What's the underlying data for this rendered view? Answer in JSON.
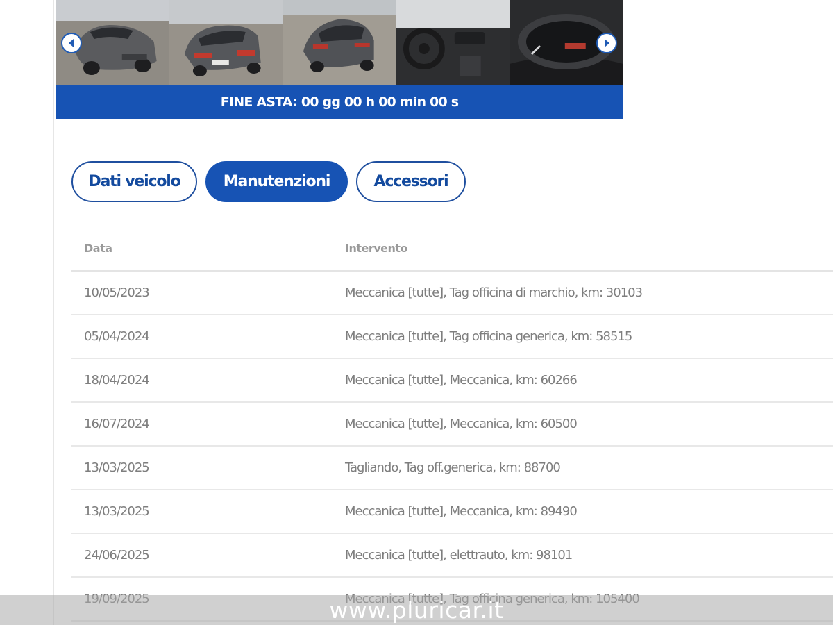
{
  "gallery": {
    "photos": [
      {
        "icon": "car-front-photo"
      },
      {
        "icon": "car-rear-photo"
      },
      {
        "icon": "car-rear-side-photo"
      },
      {
        "icon": "steering-wheel-photo"
      },
      {
        "icon": "dashboard-cluster-photo"
      }
    ],
    "prev_icon": "chevron-left-icon",
    "next_icon": "chevron-right-icon"
  },
  "countdown": {
    "label": "FINE ASTA:",
    "value": "00 gg 00 h 00 min 00 s"
  },
  "tabs": [
    {
      "label": "Dati veicolo",
      "active": false
    },
    {
      "label": "Manutenzioni",
      "active": true
    },
    {
      "label": "Accessori",
      "active": false
    }
  ],
  "table": {
    "headers": [
      "Data",
      "Intervento"
    ],
    "rows": [
      {
        "date": "10/05/2023",
        "intervento": "Meccanica [tutte], Tag officina di marchio, km: 30103"
      },
      {
        "date": "05/04/2024",
        "intervento": "Meccanica [tutte], Tag officina generica, km: 58515"
      },
      {
        "date": "18/04/2024",
        "intervento": "Meccanica [tutte], Meccanica, km: 60266"
      },
      {
        "date": "16/07/2024",
        "intervento": "Meccanica [tutte], Meccanica, km: 60500"
      },
      {
        "date": "13/03/2025",
        "intervento": "Tagliando, Tag off.generica, km: 88700"
      },
      {
        "date": "13/03/2025",
        "intervento": "Meccanica [tutte], Meccanica, km: 89490"
      },
      {
        "date": "24/06/2025",
        "intervento": "Meccanica [tutte], elettrauto, km: 98101"
      },
      {
        "date": "19/09/2025",
        "intervento": "Meccanica [tutte], Tag officina generica, km: 105400"
      }
    ]
  },
  "watermark": "www.pluricar.it",
  "colors": {
    "accent": "#1753b4",
    "tab_border": "#1f4f9f",
    "text_muted": "#7e7e7e"
  }
}
